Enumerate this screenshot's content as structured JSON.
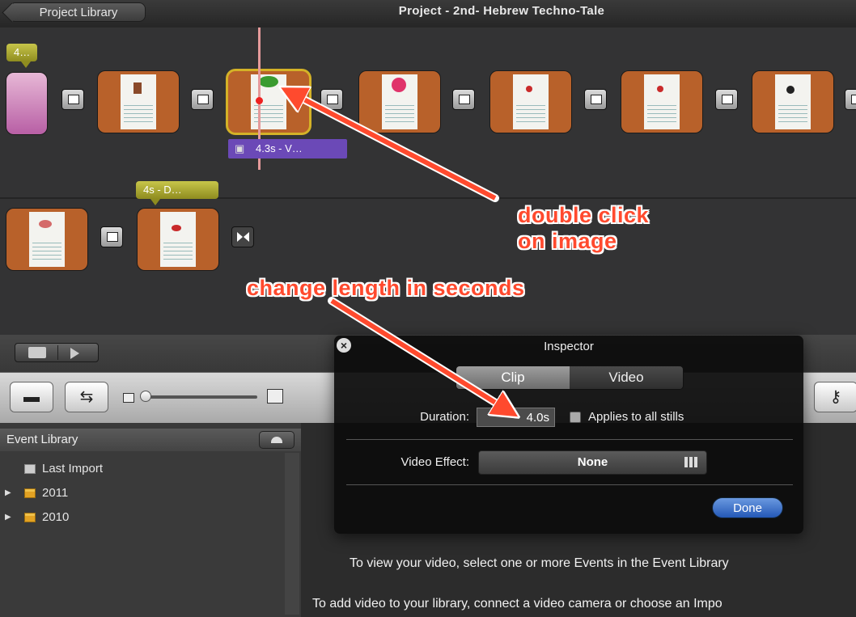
{
  "window": {
    "back_label": "Project Library",
    "project_title": "Project - 2nd- Hebrew Techno-Tale"
  },
  "timeline": {
    "flag_first": "4…",
    "flag_second_row": "4s - D…",
    "selected_clip_label": "4.3s - V…"
  },
  "annotations": {
    "double_click_line1": "double click",
    "double_click_line2": "on image",
    "change_length": "change length in seconds"
  },
  "inspector": {
    "title": "Inspector",
    "tabs": [
      {
        "label": "Clip"
      },
      {
        "label": "Video"
      }
    ],
    "duration_label": "Duration:",
    "duration_value": "4.0s",
    "applies_label": "Applies to all stills",
    "video_effect_label": "Video Effect:",
    "video_effect_value": "None",
    "done_label": "Done"
  },
  "event_library": {
    "header": "Event Library",
    "items": [
      {
        "label": "Last Import"
      },
      {
        "label": "2011"
      },
      {
        "label": "2010"
      }
    ]
  },
  "main": {
    "hint_line1": "To view your video, select one or more Events in the Event Library",
    "hint_line2": "To add video to your library, connect a video camera or choose an Impo"
  },
  "icons": {
    "back": "back-arrow-icon",
    "camera": "camera-icon",
    "swap": "swap-icon",
    "key": "key-icon",
    "close": "close-icon",
    "grid": "grid-icon"
  }
}
